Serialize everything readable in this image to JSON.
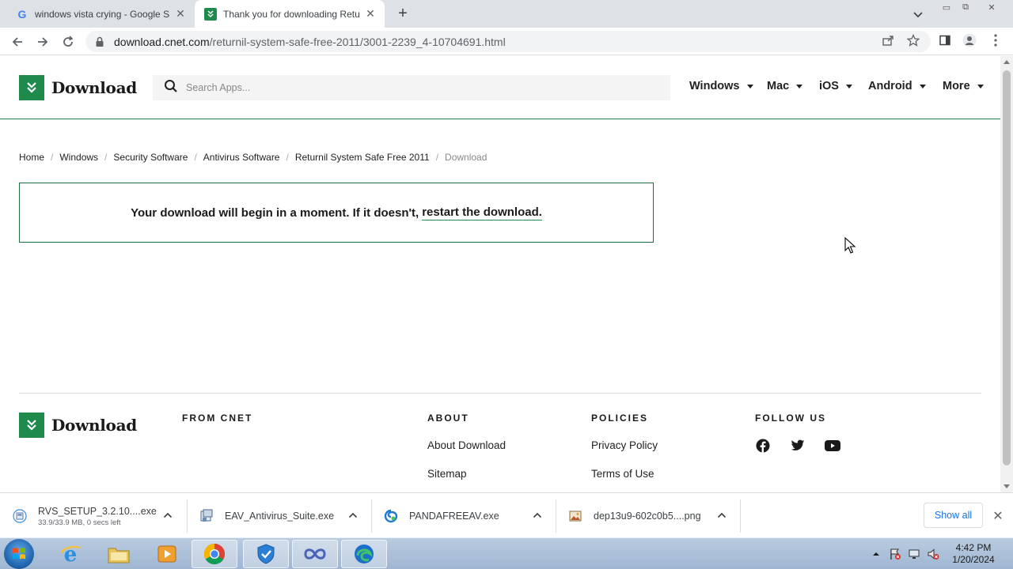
{
  "browser": {
    "tabs": [
      {
        "title": "windows vista crying - Google Se"
      },
      {
        "title": "Thank you for downloading Retu"
      }
    ],
    "url_host": "download.cnet.com",
    "url_path": "/returnil-system-safe-free-2011/3001-2239_4-10704691.html"
  },
  "site": {
    "logo_text": "Download",
    "search_placeholder": "Search Apps...",
    "nav": [
      "Windows",
      "Mac",
      "iOS",
      "Android",
      "More"
    ]
  },
  "breadcrumb": [
    "Home",
    "Windows",
    "Security Software",
    "Antivirus Software",
    "Returnil System Safe Free 2011",
    "Download"
  ],
  "notice": {
    "text": "Your download will begin in a moment. If it doesn't,",
    "link": "restart the download."
  },
  "footer": {
    "logo_text": "Download",
    "columns": [
      {
        "heading": "FROM CNET",
        "links": []
      },
      {
        "heading": "ABOUT",
        "links": [
          "About Download",
          "Sitemap"
        ]
      },
      {
        "heading": "POLICIES",
        "links": [
          "Privacy Policy",
          "Terms of Use"
        ]
      },
      {
        "heading": "FOLLOW US",
        "links": []
      }
    ],
    "social_icons": [
      "facebook-icon",
      "twitter-icon",
      "youtube-icon"
    ]
  },
  "downloads": {
    "items": [
      {
        "name": "RVS_SETUP_3.2.10....exe",
        "status": "33.9/33.9 MB, 0 secs left"
      },
      {
        "name": "EAV_Antivirus_Suite.exe"
      },
      {
        "name": "PANDAFREEAV.exe"
      },
      {
        "name": "dep13u9-602c0b5....png"
      }
    ],
    "show_all": "Show all"
  },
  "taskbar": {
    "time": "4:42 PM",
    "date": "1/20/2024"
  },
  "colors": {
    "brand_green": "#1e8a4c",
    "link_blue": "#1a73e8"
  }
}
